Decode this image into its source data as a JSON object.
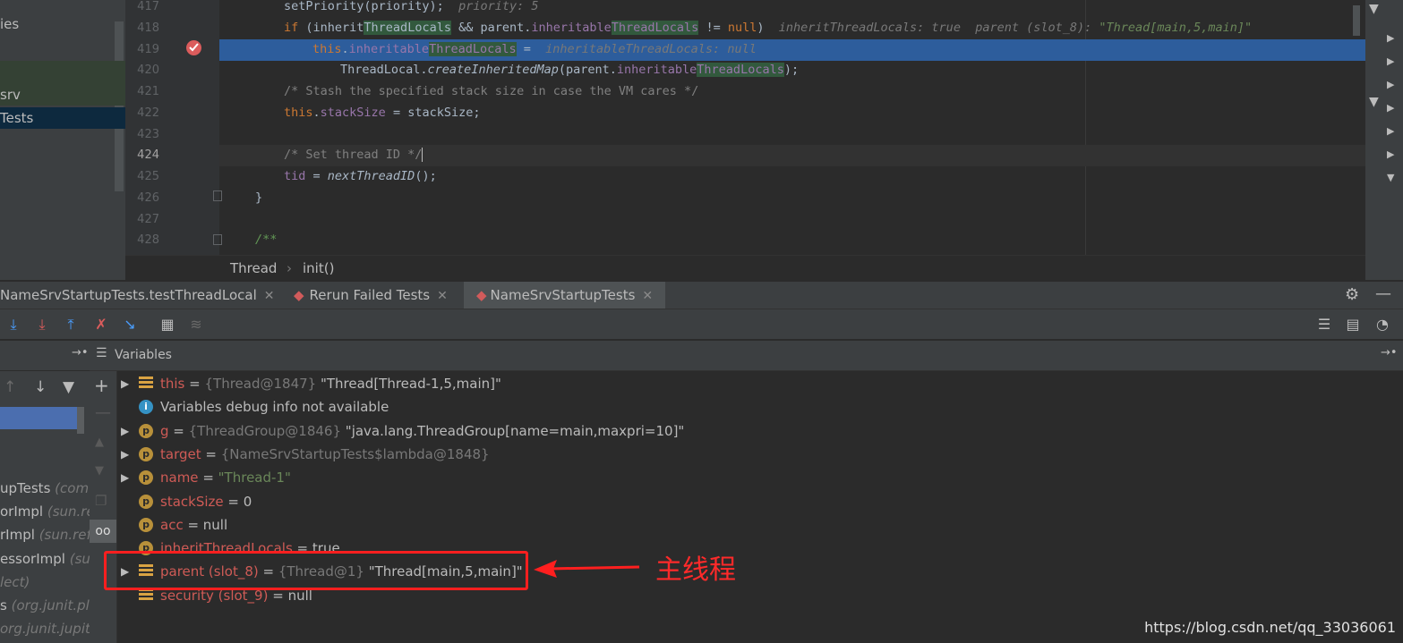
{
  "project_tree": {
    "items": [
      {
        "label": "ies"
      },
      {
        "label": "srv"
      },
      {
        "label": "Tests"
      }
    ]
  },
  "editor": {
    "lines": [
      {
        "num": "417",
        "code": "setPriority(priority);",
        "inline": "priority: 5"
      },
      {
        "num": "418",
        "code": "if (inheritThreadLocals && parent.inheritableThreadLocals != null)",
        "inline_a": "inheritThreadLocals: true",
        "inline_b": "parent (slot_8):",
        "inline_str": "\"Thread[main,5,main]\""
      },
      {
        "num": "419",
        "code": "this.inheritableThreadLocals =",
        "inline": "inheritableThreadLocals: null"
      },
      {
        "num": "420",
        "code": "ThreadLocal.createInheritedMap(parent.inheritableThreadLocals);"
      },
      {
        "num": "421",
        "code": "/* Stash the specified stack size in case the VM cares */"
      },
      {
        "num": "422",
        "code": "this.stackSize = stackSize;"
      },
      {
        "num": "423",
        "code": ""
      },
      {
        "num": "424",
        "code": "/* Set thread ID */"
      },
      {
        "num": "425",
        "code": "tid = nextThreadID();"
      },
      {
        "num": "426",
        "code": "}"
      },
      {
        "num": "427",
        "code": ""
      },
      {
        "num": "428",
        "code": "/**"
      }
    ],
    "breadcrumb": {
      "class": "Thread",
      "sep": "›",
      "method": "init()"
    }
  },
  "debug_tabs": [
    {
      "label": "NameSrvStartupTests.testThreadLocal"
    },
    {
      "label": "Rerun Failed Tests"
    },
    {
      "label": "NameSrvStartupTests"
    }
  ],
  "variables_header": "Variables",
  "frames": [
    {
      "name": "upTests",
      "loc": "(com"
    },
    {
      "name": "orImpl",
      "loc": "(sun.refl"
    },
    {
      "name": "rImpl",
      "loc": "(sun.refl"
    },
    {
      "name": "essorImpl",
      "loc": "(sun"
    },
    {
      "name": "",
      "loc": "lect)"
    },
    {
      "name": "s",
      "loc": "(org.junit.pla"
    },
    {
      "name": "",
      "loc": "org.junit.jupite"
    }
  ],
  "variables": [
    {
      "name": "this",
      "eq": " = ",
      "type": "{Thread@1847}",
      "value": " \"Thread[Thread-1,5,main]\""
    },
    {
      "name": "Variables debug info not available"
    },
    {
      "name": "g",
      "eq": " = ",
      "type": "{ThreadGroup@1846}",
      "value": " \"java.lang.ThreadGroup[name=main,maxpri=10]\""
    },
    {
      "name": "target",
      "eq": " = ",
      "type": "{NameSrvStartupTests$lambda@1848}"
    },
    {
      "name": "name",
      "eq": " = ",
      "value": "\"Thread-1\""
    },
    {
      "name": "stackSize",
      "eq": " = ",
      "value": "0"
    },
    {
      "name": "acc",
      "eq": " = ",
      "value": "null"
    },
    {
      "name": "inheritThreadLocals",
      "eq": " = ",
      "value": "true"
    },
    {
      "name": "parent (slot_8)",
      "eq": " = ",
      "type": "{Thread@1}",
      "value": " \"Thread[main,5,main]\""
    },
    {
      "name": "security (slot_9)",
      "eq": " = ",
      "value": "null"
    }
  ],
  "annotation": {
    "text": "主线程",
    "color": "#ff2a2a"
  },
  "watermark": "https://blog.csdn.net/qq_33036061",
  "colors": {
    "breakpoint_line": "#2d5d9c",
    "keyword": "#cc7832",
    "field": "#9876aa",
    "string": "#6a8759"
  }
}
